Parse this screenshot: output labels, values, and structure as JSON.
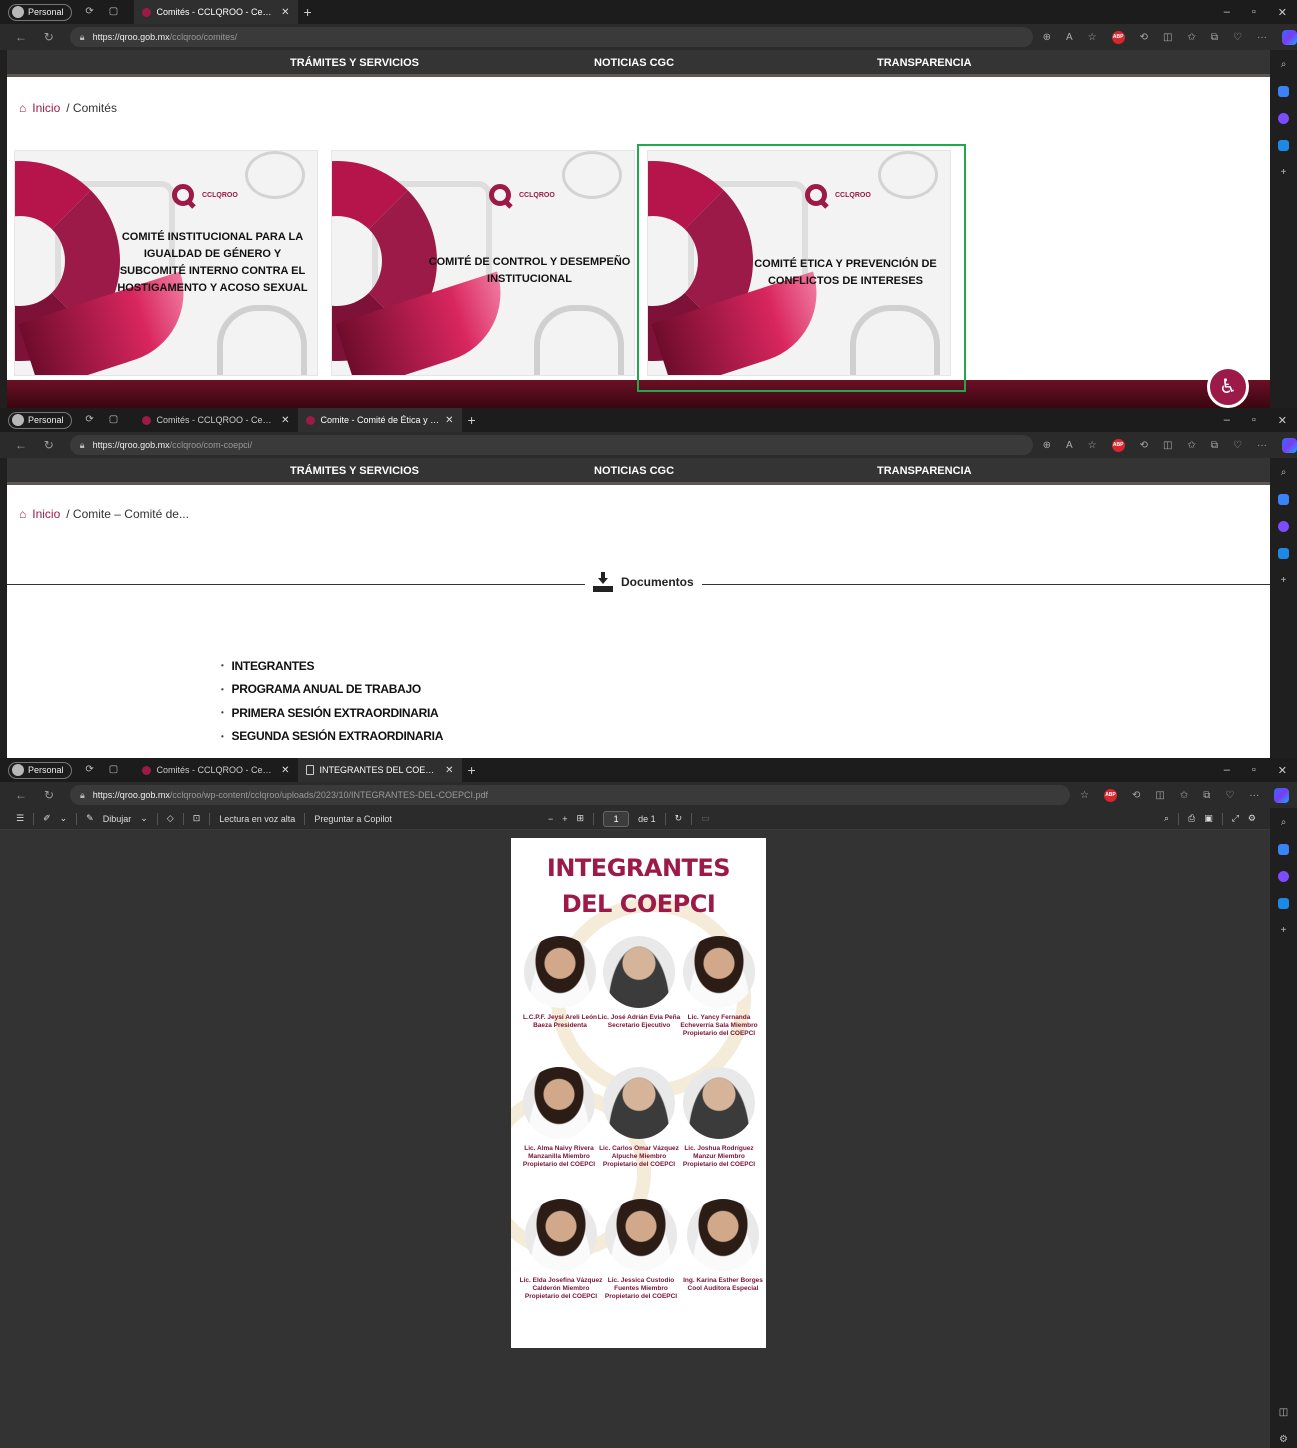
{
  "browser": {
    "profile_label": "Personal",
    "window_controls": [
      "–",
      "▫",
      "✕"
    ]
  },
  "panel1": {
    "tabs": [
      {
        "title": "Comités - CCLQROO - Centro de"
      }
    ],
    "url_host": "https://qroo.gob.mx",
    "url_path": "/cclqroo/comites/"
  },
  "panel2": {
    "tabs": [
      {
        "title": "Comités - CCLQROO - Centro de"
      },
      {
        "title": "Comite - Comité de Ética y Prev"
      }
    ],
    "url_host": "https://qroo.gob.mx",
    "url_path": "/cclqroo/com-coepci/"
  },
  "panel3": {
    "tabs": [
      {
        "title": "Comités - CCLQROO - Centro de"
      },
      {
        "title": "INTEGRANTES DEL COEPCI"
      }
    ],
    "url_host": "https://qroo.gob.mx",
    "url_path": "/cclqroo/wp-content/cclqroo/uploads/2023/10/INTEGRANTES-DEL-COEPCI.pdf"
  },
  "site": {
    "nav": [
      "TRÁMITES Y SERVICIOS",
      "NOTICIAS CGC",
      "TRANSPARENCIA"
    ],
    "home_link": "Inicio",
    "breadcrumb_comites": "/ Comités",
    "breadcrumb_comite": "/ Comite – Comité de...",
    "logo_text": "CCLQROO",
    "cards": [
      {
        "title": "COMITÉ INSTITUCIONAL PARA LA IGUALDAD DE GÉNERO Y SUBCOMITÉ INTERNO CONTRA EL HOSTIGAMENTO Y ACOSO SEXUAL"
      },
      {
        "title": "COMITÉ DE CONTROL Y DESEMPEÑO INSTITUCIONAL"
      },
      {
        "title": "COMITÉ ETICA Y PREVENCIÓN DE CONFLICTOS DE INTERESES"
      }
    ],
    "documents_label": "Documentos",
    "documents": [
      "INTEGRANTES",
      "PROGRAMA ANUAL DE TRABAJO",
      "PRIMERA SESIÓN EXTRAORDINARIA",
      "SEGUNDA SESIÓN EXTRAORDINARIA"
    ]
  },
  "pdf_toolbar": {
    "draw_label": "Dibujar",
    "read_aloud_label": "Lectura en voz alta",
    "copilot_label": "Preguntar a Copilot",
    "page_current": "1",
    "page_total": "de 1"
  },
  "pdf": {
    "title_line1": "INTEGRANTES",
    "title_line2": "DEL COEPCI",
    "members": [
      {
        "caption": "L.C.P.F. Jeysi Areli León Baeza Presidenta",
        "female": true
      },
      {
        "caption": "Lic. José Adrián Evia Peña Secretario Ejecutivo",
        "female": false
      },
      {
        "caption": "Lic. Yancy Fernanda Echeverría Sala Miembro Propietario del COEPCI",
        "female": true
      },
      {
        "caption": "Lic. Alma Naivy Rivera Manzanilla Miembro Propietario del COEPCI",
        "female": true
      },
      {
        "caption": "Lic. Carlos Omar Vázquez Alpuche Miembro Propietario del COEPCI",
        "female": false
      },
      {
        "caption": "Lic. Joshua Rodríguez Manzur Miembro Propietario del COEPCI",
        "female": false
      },
      {
        "caption": "Lic. Elda Josefina Vázquez Calderón Miembro Propietario del COEPCI",
        "female": true
      },
      {
        "caption": "Lic. Jessica Custodio Fuentes Miembro Propietario del COEPCI",
        "female": true
      },
      {
        "caption": "Ing. Karina Esther Borges Cool Auditora Especial",
        "female": true
      }
    ]
  },
  "colors": {
    "brand": "#9c1a47",
    "selection": "#22a84a",
    "nav_bg": "#343434"
  }
}
